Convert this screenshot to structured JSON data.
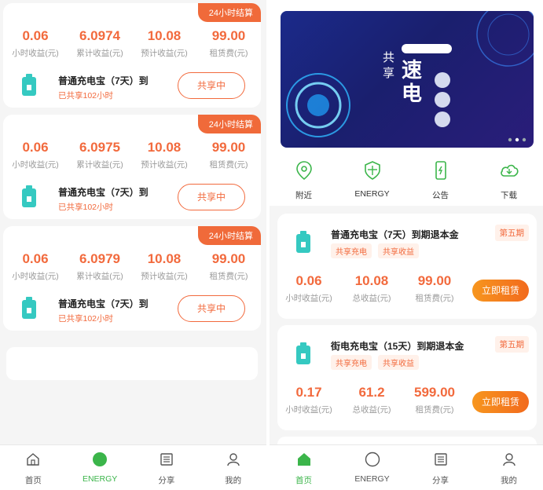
{
  "left": {
    "cards": [
      {
        "badge": "24小时结算",
        "stats": [
          {
            "value": "0.06",
            "label": "小时收益(元)"
          },
          {
            "value": "6.0974",
            "label": "累计收益(元)"
          },
          {
            "value": "10.08",
            "label": "预计收益(元)"
          },
          {
            "value": "99.00",
            "label": "租赁费(元)"
          }
        ],
        "title": "普通充电宝（7天）到",
        "sub": "已共享102小时",
        "button": "共享中"
      },
      {
        "badge": "24小时结算",
        "stats": [
          {
            "value": "0.06",
            "label": "小时收益(元)"
          },
          {
            "value": "6.0975",
            "label": "累计收益(元)"
          },
          {
            "value": "10.08",
            "label": "预计收益(元)"
          },
          {
            "value": "99.00",
            "label": "租赁费(元)"
          }
        ],
        "title": "普通充电宝（7天）到",
        "sub": "已共享102小时",
        "button": "共享中"
      },
      {
        "badge": "24小时结算",
        "stats": [
          {
            "value": "0.06",
            "label": "小时收益(元)"
          },
          {
            "value": "6.0979",
            "label": "累计收益(元)"
          },
          {
            "value": "10.08",
            "label": "预计收益(元)"
          },
          {
            "value": "99.00",
            "label": "租赁费(元)"
          }
        ],
        "title": "普通充电宝（7天）到",
        "sub": "已共享102小时",
        "button": "共享中"
      }
    ],
    "nav": [
      {
        "label": "首页",
        "icon": "home-icon"
      },
      {
        "label": "ENERGY",
        "icon": "circle-icon"
      },
      {
        "label": "分享",
        "icon": "list-icon"
      },
      {
        "label": "我的",
        "icon": "user-icon"
      }
    ]
  },
  "right": {
    "banner": {
      "title_small1": "共",
      "title_small2": "享",
      "title_big1": "速",
      "title_big2": "电"
    },
    "quick": [
      {
        "label": "附近",
        "icon": "location-icon"
      },
      {
        "label": "ENERGY",
        "icon": "shield-icon"
      },
      {
        "label": "公告",
        "icon": "phone-icon"
      },
      {
        "label": "下载",
        "icon": "cloud-icon"
      }
    ],
    "cards": [
      {
        "title": "普通充电宝（7天）到期退本金",
        "tags": [
          "共享充电",
          "共享收益"
        ],
        "period": "第五期",
        "stats": [
          {
            "value": "0.06",
            "label": "小时收益(元)"
          },
          {
            "value": "10.08",
            "label": "总收益(元)"
          },
          {
            "value": "99.00",
            "label": "租赁费(元)"
          }
        ],
        "button": "立即租赁"
      },
      {
        "title": "街电充电宝（15天）到期退本金",
        "tags": [
          "共享充电",
          "共享收益"
        ],
        "period": "第五期",
        "stats": [
          {
            "value": "0.17",
            "label": "小时收益(元)"
          },
          {
            "value": "61.2",
            "label": "总收益(元)"
          },
          {
            "value": "599.00",
            "label": "租赁费(元)"
          }
        ],
        "button": "立即租赁"
      }
    ],
    "nav": [
      {
        "label": "首页",
        "icon": "home-icon"
      },
      {
        "label": "ENERGY",
        "icon": "circle-icon"
      },
      {
        "label": "分享",
        "icon": "list-icon"
      },
      {
        "label": "我的",
        "icon": "user-icon"
      }
    ]
  },
  "colors": {
    "accent": "#f26a3d",
    "green": "#3bb54a",
    "teal": "#35c9c1"
  }
}
